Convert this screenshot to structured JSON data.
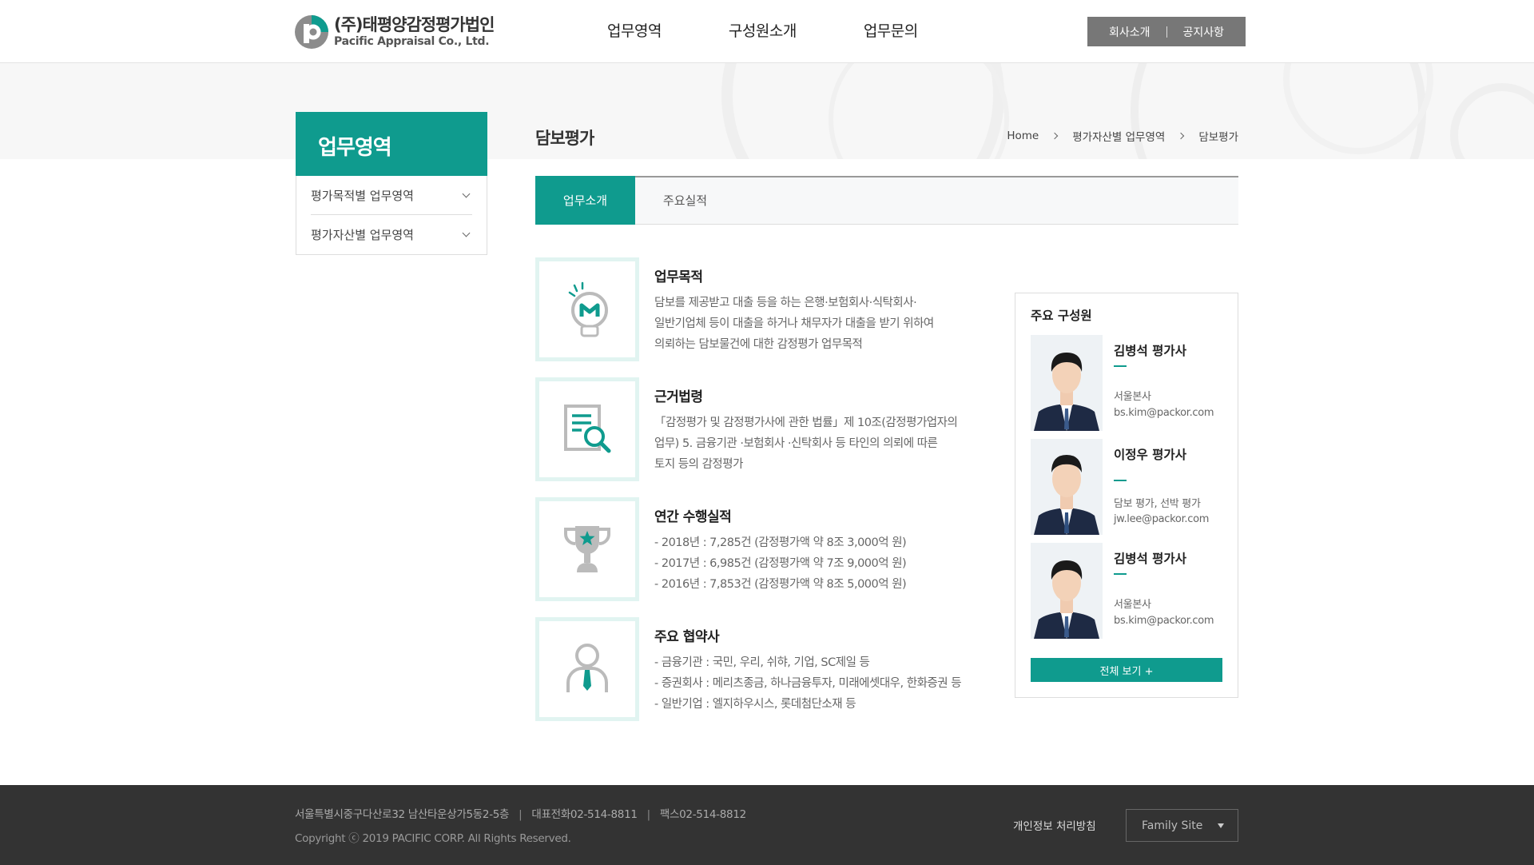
{
  "header": {
    "logo_ko": "(주)태평양감정평가법인",
    "logo_en": "Pacific Appraisal Co., Ltd.",
    "nav": [
      "업무영역",
      "구성원소개",
      "업무문의"
    ],
    "util": [
      "회사소개",
      "공지사항"
    ]
  },
  "lnb": {
    "title": "업무영역",
    "items": [
      "평가목적별 업무영역",
      "평가자산별 업무영역"
    ]
  },
  "content": {
    "title": "담보평가",
    "breadcrumb": [
      "Home",
      "평가자산별 업무영역",
      "담보평가"
    ],
    "tabs": [
      "업무소개",
      "주요실적"
    ],
    "active_tab": "업무소개",
    "sections": [
      {
        "icon": "lightbulb-icon",
        "heading": "업무목적",
        "lines": [
          "담보를 제공받고 대출 등을 하는 은행·보험회사·식탁회사·",
          "일반기업체 등이 대출을 하거나 채무자가 대출을 받기 위하여",
          "의뢰하는 담보물건에 대한 감정평가 업무목적"
        ]
      },
      {
        "icon": "document-search-icon",
        "heading": "근거법령",
        "lines": [
          "「감정평가 및 감정평가사에 관한 법률」제 10조(감정평가업자의",
          "업무) 5. 금융기관 ·보험회사 ·신탁회사 등 타인의 의뢰에 따른",
          "토지 등의 감정평가"
        ]
      },
      {
        "icon": "trophy-icon",
        "heading": "연간 수행실적",
        "lines": [
          "- 2018년 : 7,285건 (감정평가액 약 8조 3,000억 원)",
          "- 2017년 : 6,985건 (감정평가액 약 7조 9,000억 원)",
          "- 2016년 : 7,853건 (감정평가액 약 8조 5,000억 원)"
        ]
      },
      {
        "icon": "person-tie-icon",
        "heading": "주요 협약사",
        "lines": [
          "- 금융기관 : 국민, 우리, 쉬햐, 기업, SC제일 등",
          "- 증권회사 : 메리츠종금, 하나금융투자, 미래에셋대우, 한화증권 등",
          "- 일반기업 : 엘지하우시스, 롯데첨단소재 등"
        ]
      }
    ]
  },
  "members": {
    "title": "주요 구성원",
    "list": [
      {
        "name": "김병석 평가사",
        "info": [
          "서울본사",
          "bs.kim@packor.com"
        ]
      },
      {
        "name": "이정우 평가사",
        "info": [
          "담보 평가, 선박 평가",
          "jw.lee@packor.com"
        ]
      },
      {
        "name": "김병석 평가사",
        "info": [
          "서울본사",
          "bs.kim@packor.com"
        ]
      }
    ],
    "more": "전체 보기 +"
  },
  "footer": {
    "address": "서울특별시중구다산로32 남산타운상가5동2-5층",
    "tel": "대표전화02-514-8811",
    "fax": "팩스02-514-8812",
    "separator": "|",
    "copyright": "Copyright ⓒ 2019 PACIFIC CORP. All Rights Reserved.",
    "privacy": "개인정보 처리방침",
    "family_site": "Family Site"
  },
  "colors": {
    "accent": "#0f9b8e",
    "footer_bg": "#333333",
    "util_bg": "#777777"
  }
}
